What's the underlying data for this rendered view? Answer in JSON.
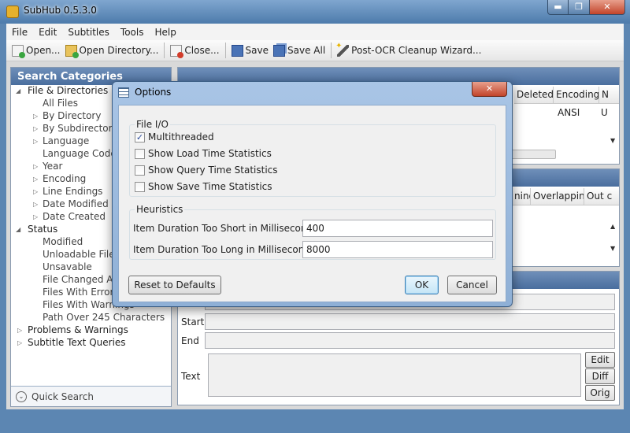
{
  "window": {
    "title": "SubHub 0.5.3.0",
    "minimize": "▬",
    "maximize": "❐",
    "close": "✕"
  },
  "menu": [
    "File",
    "Edit",
    "Subtitles",
    "Tools",
    "Help"
  ],
  "toolbar": {
    "open": "Open...",
    "open_directory": "Open Directory...",
    "close": "Close...",
    "save": "Save",
    "save_all": "Save All",
    "post_ocr": "Post-OCR Cleanup Wizard..."
  },
  "left_panel": {
    "title": "Search Categories",
    "tree": [
      {
        "label": "File & Directories",
        "expanded": true
      },
      {
        "label": "All Files"
      },
      {
        "label": "By Directory"
      },
      {
        "label": "By Subdirectories"
      },
      {
        "label": "Language"
      },
      {
        "label": "Language Code"
      },
      {
        "label": "Year"
      },
      {
        "label": "Encoding"
      },
      {
        "label": "Line Endings"
      },
      {
        "label": "Date Modified"
      },
      {
        "label": "Date Created"
      },
      {
        "label": "Status",
        "expanded": true
      },
      {
        "label": "Modified"
      },
      {
        "label": "Unloadable Files"
      },
      {
        "label": "Unsavable"
      },
      {
        "label": "File Changed After"
      },
      {
        "label": "Files With Errors"
      },
      {
        "label": "Files With Warnings"
      },
      {
        "label": "Path Over 245 Characters"
      },
      {
        "label": "Problems & Warnings"
      },
      {
        "label": "Subtitle Text Queries"
      }
    ],
    "quick_search": "Quick Search"
  },
  "files_grid": {
    "columns": [
      "Deleted",
      "Encoding",
      "N"
    ],
    "row": {
      "encoding": "ANSI",
      "n": "U"
    }
  },
  "items_grid": {
    "columns": [
      "ning",
      "Overlapping",
      "Out c"
    ]
  },
  "editor": {
    "start_label": "Start",
    "end_label": "End",
    "text_label": "Text",
    "edit_button": "Edit",
    "diff_button": "Diff",
    "orig_button": "Orig"
  },
  "dialog": {
    "title": "Options",
    "close": "✕",
    "file_io": {
      "title": "File I/O",
      "options": [
        {
          "label": "Multithreaded",
          "checked": true
        },
        {
          "label": "Show Load Time Statistics",
          "checked": false
        },
        {
          "label": "Show Query Time Statistics",
          "checked": false
        },
        {
          "label": "Show Save Time Statistics",
          "checked": false
        }
      ]
    },
    "heuristics": {
      "title": "Heuristics",
      "too_short_label": "Item Duration Too Short in Milliseconds",
      "too_short_value": "400",
      "too_long_label": "Item Duration Too Long in Milliseconds",
      "too_long_value": "8000"
    },
    "reset_button": "Reset to Defaults",
    "ok_button": "OK",
    "cancel_button": "Cancel"
  }
}
